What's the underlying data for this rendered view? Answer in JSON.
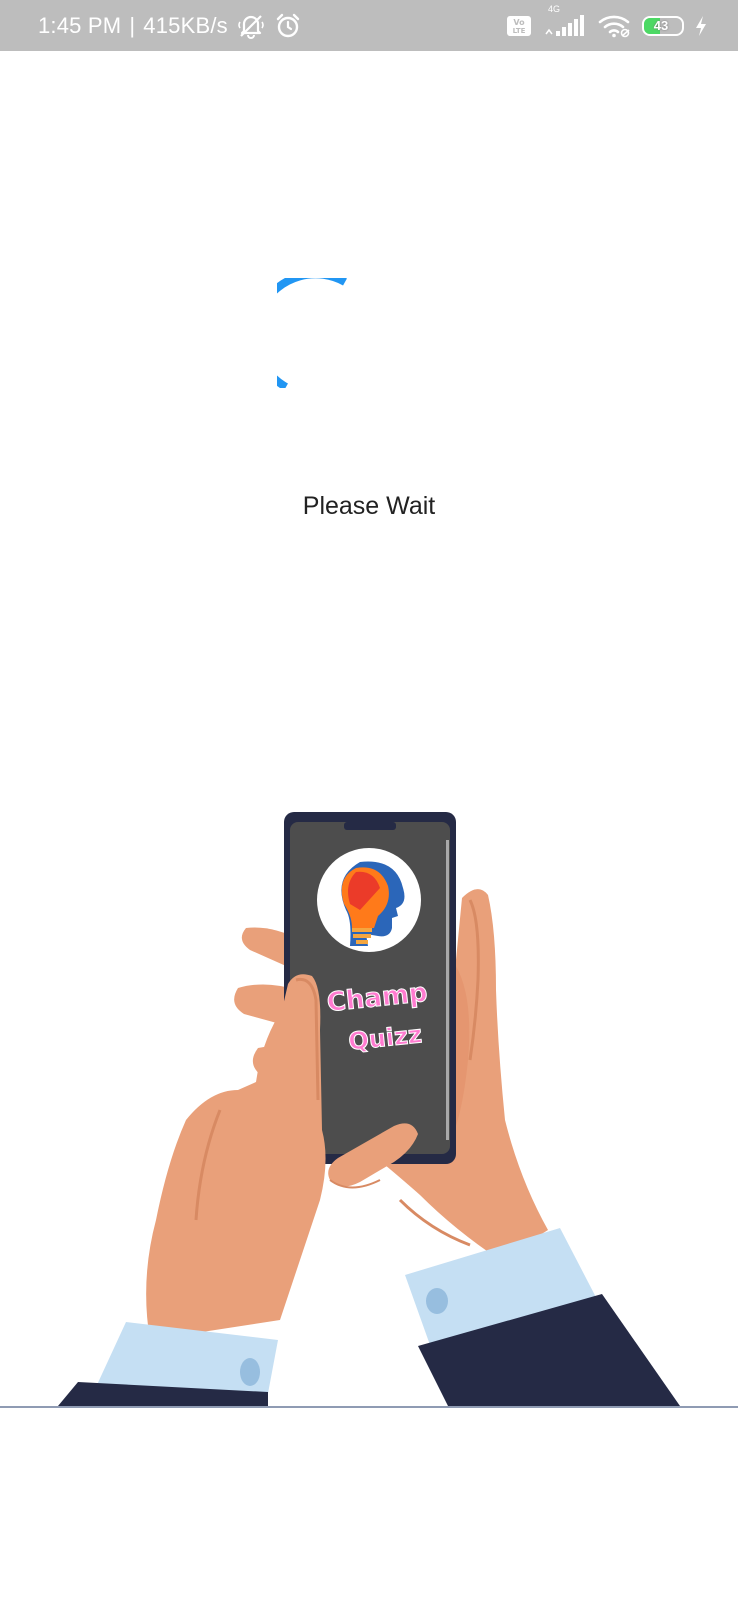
{
  "status_bar": {
    "time": "1:45 PM",
    "separator": "|",
    "network_speed": "415KB/s",
    "battery_level": "43",
    "battery_fraction": 0.43,
    "network_type": "4G",
    "volte_label": "Vo LTE",
    "icons": [
      "mute-icon",
      "alarm-icon",
      "volte-icon",
      "signal-icon",
      "wifi-icon",
      "battery-icon",
      "charging-icon"
    ]
  },
  "loader": {
    "message": "Please Wait",
    "spinner_color": "#2196f3"
  },
  "illustration": {
    "app_name_line1": "Champ",
    "app_name_line2": "Quizz",
    "app_name_color": "#ff7bd0"
  }
}
